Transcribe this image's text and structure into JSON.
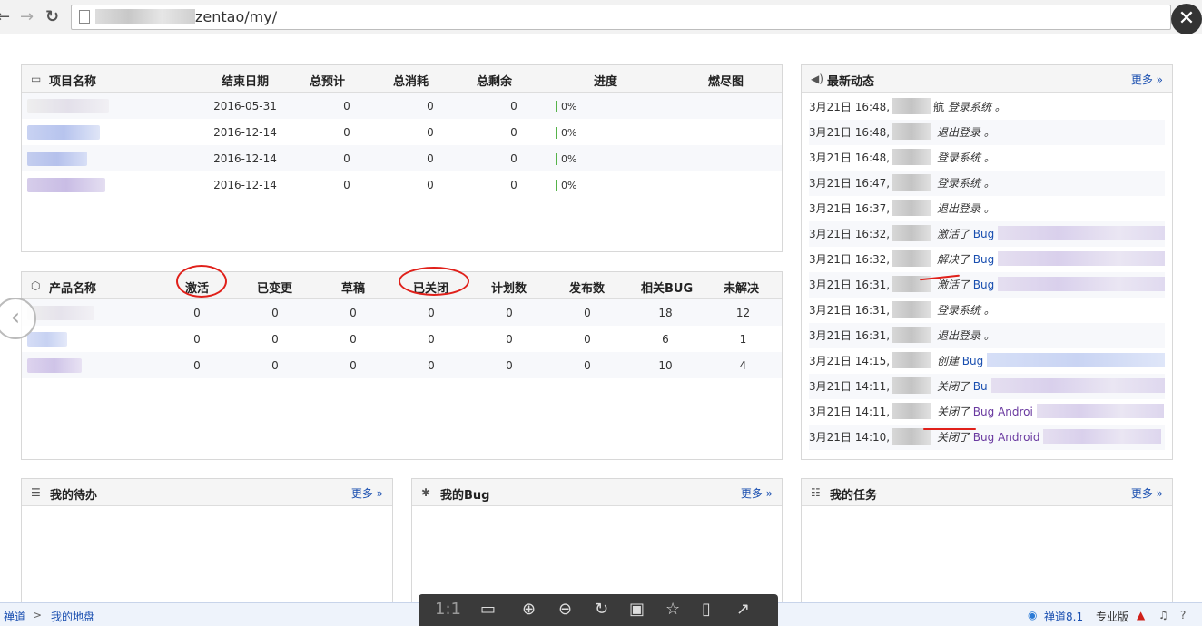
{
  "browser": {
    "back": "←",
    "forward": "→",
    "reload": "↻",
    "url_suffix": "zentao/my/",
    "close": "✕"
  },
  "projects": {
    "headers": [
      "项目名称",
      "结束日期",
      "总预计",
      "总消耗",
      "总剩余",
      "进度",
      "燃尽图"
    ],
    "rows": [
      {
        "end": "2016-05-31",
        "estimate": "0",
        "consumed": "0",
        "left": "0",
        "progress": "0%"
      },
      {
        "end": "2016-12-14",
        "estimate": "0",
        "consumed": "0",
        "left": "0",
        "progress": "0%"
      },
      {
        "end": "2016-12-14",
        "estimate": "0",
        "consumed": "0",
        "left": "0",
        "progress": "0%"
      },
      {
        "end": "2016-12-14",
        "estimate": "0",
        "consumed": "0",
        "left": "0",
        "progress": "0%"
      }
    ]
  },
  "products": {
    "headers": [
      "产品名称",
      "激活",
      "已变更",
      "草稿",
      "已关闭",
      "计划数",
      "发布数",
      "相关BUG",
      "未解决"
    ],
    "rows": [
      {
        "active": "0",
        "changed": "0",
        "draft": "0",
        "closed": "0",
        "plans": "0",
        "releases": "0",
        "bugs": "18",
        "unresolved": "12"
      },
      {
        "active": "0",
        "changed": "0",
        "draft": "0",
        "closed": "0",
        "plans": "0",
        "releases": "0",
        "bugs": "6",
        "unresolved": "1"
      },
      {
        "active": "0",
        "changed": "0",
        "draft": "0",
        "closed": "0",
        "plans": "0",
        "releases": "0",
        "bugs": "10",
        "unresolved": "4"
      }
    ]
  },
  "dynamics": {
    "title": "最新动态",
    "more": "更多 »",
    "items": [
      {
        "time": "3月21日 16:48,",
        "mid": "航",
        "action": "登录系统 。",
        "target": ""
      },
      {
        "time": "3月21日 16:48,",
        "mid": "",
        "action": "退出登录 。",
        "target": ""
      },
      {
        "time": "3月21日 16:48,",
        "mid": "",
        "action": "登录系统 。",
        "target": ""
      },
      {
        "time": "3月21日 16:47,",
        "mid": "",
        "action": "登录系统 。",
        "target": ""
      },
      {
        "time": "3月21日 16:37,",
        "mid": "",
        "action": "退出登录 。",
        "target": ""
      },
      {
        "time": "3月21日 16:32,",
        "mid": "",
        "action": "激活了",
        "target": "Bug"
      },
      {
        "time": "3月21日 16:32,",
        "mid": "",
        "action": "解决了",
        "target": "Bug"
      },
      {
        "time": "3月21日 16:31,",
        "mid": "",
        "action": "激活了",
        "target": "Bug"
      },
      {
        "time": "3月21日 16:31,",
        "mid": "",
        "action": "登录系统 。",
        "target": ""
      },
      {
        "time": "3月21日 16:31,",
        "mid": "",
        "action": "退出登录 。",
        "target": ""
      },
      {
        "time": "3月21日 14:15,",
        "mid": "",
        "action": "创建",
        "target": "Bug"
      },
      {
        "time": "3月21日 14:11,",
        "mid": "",
        "action": "关闭了",
        "target": "Bu"
      },
      {
        "time": "3月21日 14:11,",
        "mid": "",
        "action": "关闭了",
        "target": "Bug Androi"
      },
      {
        "time": "3月21日 14:10,",
        "mid": "",
        "action": "关闭了",
        "target": "Bug Android"
      }
    ]
  },
  "todo": {
    "title": "我的待办",
    "more": "更多 »"
  },
  "mybug": {
    "title": "我的Bug",
    "more": "更多 »"
  },
  "tasks": {
    "title": "我的任务",
    "more": "更多 »"
  },
  "status_bar": {
    "breadcrumb_home": "禅道",
    "breadcrumb_sep": ">",
    "breadcrumb_current": "我的地盘",
    "version": "禅道8.1",
    "edition": "专业版"
  },
  "viewer": {
    "ratio": "1:1",
    "icons": [
      "fit-icon",
      "zoom-in-icon",
      "zoom-out-icon",
      "rotate-icon",
      "save-icon",
      "favorite-icon",
      "phone-icon",
      "share-icon"
    ]
  }
}
